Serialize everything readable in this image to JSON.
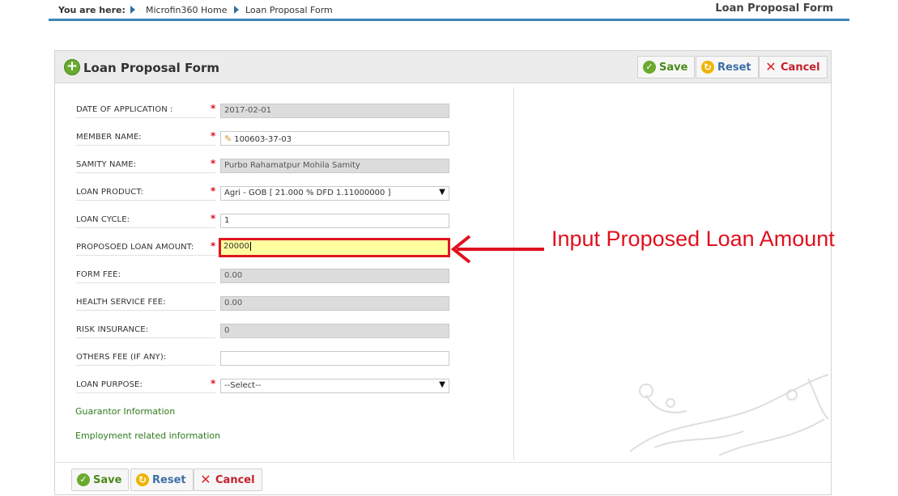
{
  "breadcrumb": {
    "prefix": "You are here:",
    "items": [
      "Microfin360 Home",
      "Loan Proposal Form"
    ]
  },
  "page_heading": "Loan Proposal Form",
  "panel": {
    "title": "Loan Proposal Form"
  },
  "buttons": {
    "save": "Save",
    "reset": "Reset",
    "cancel": "Cancel"
  },
  "form": {
    "date_of_application": {
      "label": "DATE OF APPLICATION :",
      "value": "2017-02-01"
    },
    "member_name": {
      "label": "MEMBER NAME:",
      "value": "100603-37-03"
    },
    "samity_name": {
      "label": "SAMITY NAME:",
      "value": "Purbo Rahamatpur Mohila Samity"
    },
    "loan_product": {
      "label": "LOAN PRODUCT:",
      "value": "Agri - GOB [ 21.000 % DFD 1.11000000 ]"
    },
    "loan_cycle": {
      "label": "LOAN CYCLE:",
      "value": "1"
    },
    "proposed_loan_amount": {
      "label": "PROPOSOED LOAN AMOUNT:",
      "value": "20000"
    },
    "form_fee": {
      "label": "FORM FEE:",
      "value": "0.00"
    },
    "health_service_fee": {
      "label": "HEALTH SERVICE FEE:",
      "value": "0.00"
    },
    "risk_insurance": {
      "label": "RISK INSURANCE:",
      "value": "0"
    },
    "others_fee": {
      "label": "OTHERS FEE (IF ANY):",
      "value": ""
    },
    "loan_purpose": {
      "label": "LOAN PURPOSE:",
      "value": "--Select--"
    }
  },
  "links": {
    "guarantor": "Guarantor Information",
    "employment": "Employment related information"
  },
  "annotation": {
    "text": "Input Proposed Loan Amount",
    "color": "#e0101e"
  },
  "colors": {
    "accent": "#3d86b8",
    "required": "#e0101e",
    "link": "#2e7a1c"
  },
  "icons": [
    "plus-icon",
    "check-icon",
    "reset-icon",
    "cancel-icon",
    "pencil-icon",
    "chevron-down-icon"
  ]
}
